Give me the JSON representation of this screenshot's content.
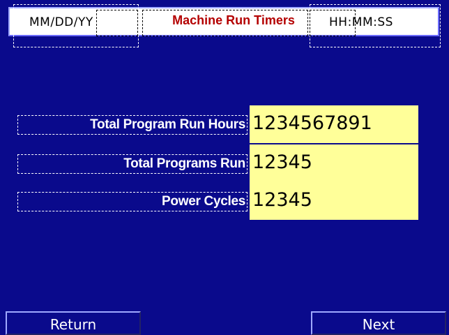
{
  "header": {
    "date_format": "MM/DD/YY",
    "title": "Machine Run Timers",
    "time_format": "HH:MM:SS"
  },
  "rows": [
    {
      "label": "Total Program Run Hours",
      "value": "1234567891"
    },
    {
      "label": "Total Programs Run",
      "value": "12345"
    },
    {
      "label": "Power Cycles",
      "value": "12345"
    }
  ],
  "buttons": {
    "return_label": "Return",
    "next_label": "Next"
  },
  "colors": {
    "background": "#0a0a8c",
    "title": "#b40000",
    "value_field": "#ffff99",
    "header_bg": "#ffffff"
  }
}
